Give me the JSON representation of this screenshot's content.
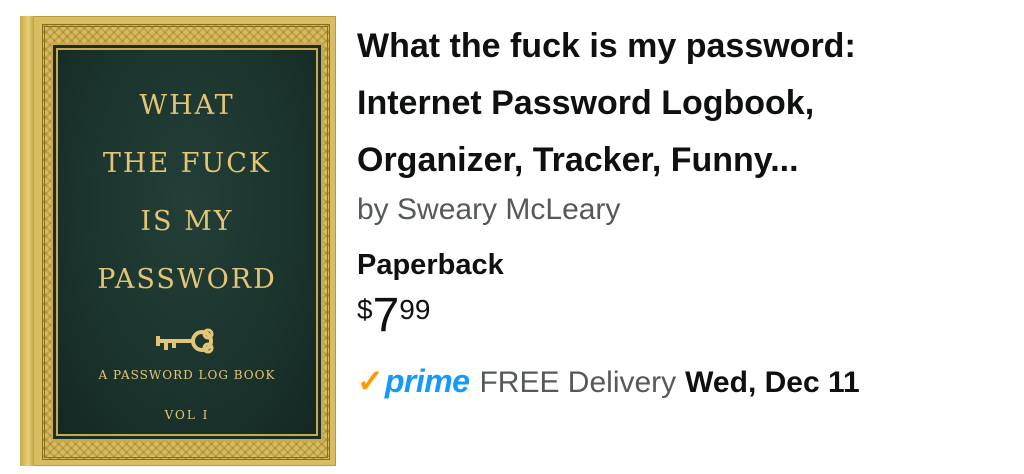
{
  "product": {
    "title_line1": "What the fuck is my password:",
    "title_line2": "Internet Password Logbook,",
    "title_line3": "Organizer, Tracker, Funny...",
    "author": "by Sweary McLeary",
    "format": "Paperback",
    "price": {
      "symbol": "$",
      "whole": "7",
      "fraction": "99"
    },
    "delivery": {
      "prime_check": "✓",
      "prime_word": "prime",
      "label": "FREE Delivery",
      "date": "Wed, Dec 11"
    }
  },
  "cover": {
    "line1": "WHAT",
    "line2": "THE FUCK",
    "line3": "IS MY",
    "line4": "PASSWORD",
    "subtitle": "A PASSWORD LOG BOOK",
    "volume": "VOL I",
    "icon": "key-icon"
  },
  "colors": {
    "cover_green": "#1b332d",
    "cover_gold": "#e2c675",
    "prime_blue": "#1399ff",
    "prime_orange": "#ff9900",
    "text_primary": "#0f1111",
    "text_secondary": "#565959"
  }
}
